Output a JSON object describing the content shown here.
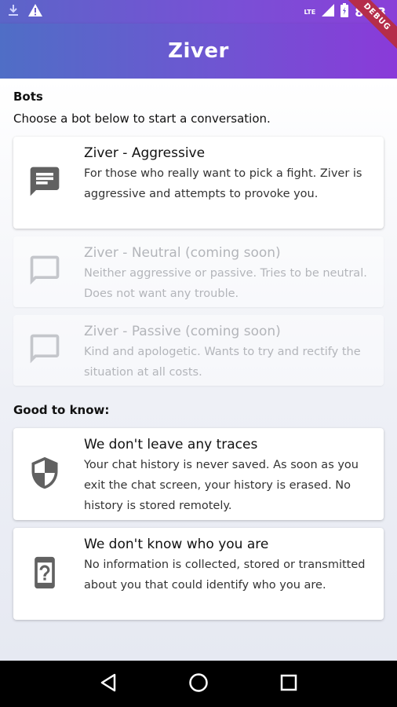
{
  "status_bar": {
    "time": "8:43",
    "network": "LTE",
    "icons": [
      "download-icon",
      "warning-icon",
      "signal-icon",
      "battery-icon"
    ]
  },
  "app_bar": {
    "title": "Ziver",
    "ribbon": "DEBUG"
  },
  "bots_section": {
    "title": "Bots",
    "subtitle": "Choose a bot below to start a conversation.",
    "items": [
      {
        "title": "Ziver - Aggressive",
        "description": "For those who really want to pick a fight. Ziver is aggressive and attempts to provoke you.",
        "icon": "chat-filled-icon",
        "enabled": true
      },
      {
        "title": "Ziver - Neutral (coming soon)",
        "description": "Neither aggressive or passive. Tries to be neutral. Does not want any trouble.",
        "icon": "chat-outline-icon",
        "enabled": false
      },
      {
        "title": "Ziver - Passive (coming soon)",
        "description": "Kind and apologetic. Wants to try and rectify the situation at all costs.",
        "icon": "chat-outline-icon",
        "enabled": false
      }
    ]
  },
  "good_to_know": {
    "title": "Good to know:",
    "items": [
      {
        "title": "We don't leave any traces",
        "description": "Your chat history is never saved. As soon as you exit the chat screen, your history is erased. No history is stored remotely.",
        "icon": "shield-icon"
      },
      {
        "title": "We don't know who you are",
        "description": "No information is collected, stored or transmitted about you that could identify who you are.",
        "icon": "unknown-device-icon"
      }
    ]
  },
  "colors": {
    "appbar_start": "#4f6ec6",
    "appbar_end": "#8a3ad9",
    "icon_active": "#616161",
    "icon_disabled": "#c4c6cb",
    "ribbon": "#b52d4a"
  }
}
